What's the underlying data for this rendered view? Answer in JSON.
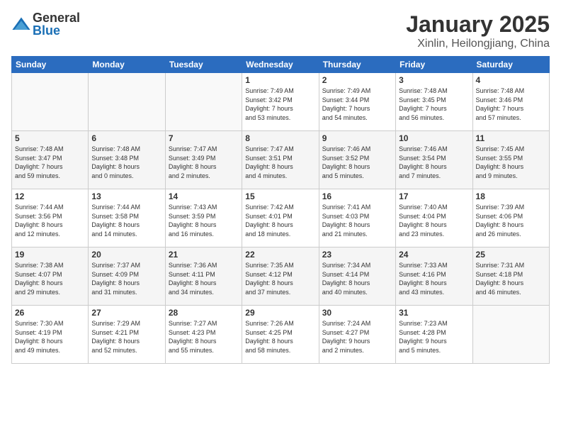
{
  "logo": {
    "general": "General",
    "blue": "Blue"
  },
  "header": {
    "month": "January 2025",
    "location": "Xinlin, Heilongjiang, China"
  },
  "days_of_week": [
    "Sunday",
    "Monday",
    "Tuesday",
    "Wednesday",
    "Thursday",
    "Friday",
    "Saturday"
  ],
  "weeks": [
    [
      {
        "day": "",
        "info": ""
      },
      {
        "day": "",
        "info": ""
      },
      {
        "day": "",
        "info": ""
      },
      {
        "day": "1",
        "info": "Sunrise: 7:49 AM\nSunset: 3:42 PM\nDaylight: 7 hours\nand 53 minutes."
      },
      {
        "day": "2",
        "info": "Sunrise: 7:49 AM\nSunset: 3:44 PM\nDaylight: 7 hours\nand 54 minutes."
      },
      {
        "day": "3",
        "info": "Sunrise: 7:48 AM\nSunset: 3:45 PM\nDaylight: 7 hours\nand 56 minutes."
      },
      {
        "day": "4",
        "info": "Sunrise: 7:48 AM\nSunset: 3:46 PM\nDaylight: 7 hours\nand 57 minutes."
      }
    ],
    [
      {
        "day": "5",
        "info": "Sunrise: 7:48 AM\nSunset: 3:47 PM\nDaylight: 7 hours\nand 59 minutes."
      },
      {
        "day": "6",
        "info": "Sunrise: 7:48 AM\nSunset: 3:48 PM\nDaylight: 8 hours\nand 0 minutes."
      },
      {
        "day": "7",
        "info": "Sunrise: 7:47 AM\nSunset: 3:49 PM\nDaylight: 8 hours\nand 2 minutes."
      },
      {
        "day": "8",
        "info": "Sunrise: 7:47 AM\nSunset: 3:51 PM\nDaylight: 8 hours\nand 4 minutes."
      },
      {
        "day": "9",
        "info": "Sunrise: 7:46 AM\nSunset: 3:52 PM\nDaylight: 8 hours\nand 5 minutes."
      },
      {
        "day": "10",
        "info": "Sunrise: 7:46 AM\nSunset: 3:54 PM\nDaylight: 8 hours\nand 7 minutes."
      },
      {
        "day": "11",
        "info": "Sunrise: 7:45 AM\nSunset: 3:55 PM\nDaylight: 8 hours\nand 9 minutes."
      }
    ],
    [
      {
        "day": "12",
        "info": "Sunrise: 7:44 AM\nSunset: 3:56 PM\nDaylight: 8 hours\nand 12 minutes."
      },
      {
        "day": "13",
        "info": "Sunrise: 7:44 AM\nSunset: 3:58 PM\nDaylight: 8 hours\nand 14 minutes."
      },
      {
        "day": "14",
        "info": "Sunrise: 7:43 AM\nSunset: 3:59 PM\nDaylight: 8 hours\nand 16 minutes."
      },
      {
        "day": "15",
        "info": "Sunrise: 7:42 AM\nSunset: 4:01 PM\nDaylight: 8 hours\nand 18 minutes."
      },
      {
        "day": "16",
        "info": "Sunrise: 7:41 AM\nSunset: 4:03 PM\nDaylight: 8 hours\nand 21 minutes."
      },
      {
        "day": "17",
        "info": "Sunrise: 7:40 AM\nSunset: 4:04 PM\nDaylight: 8 hours\nand 23 minutes."
      },
      {
        "day": "18",
        "info": "Sunrise: 7:39 AM\nSunset: 4:06 PM\nDaylight: 8 hours\nand 26 minutes."
      }
    ],
    [
      {
        "day": "19",
        "info": "Sunrise: 7:38 AM\nSunset: 4:07 PM\nDaylight: 8 hours\nand 29 minutes."
      },
      {
        "day": "20",
        "info": "Sunrise: 7:37 AM\nSunset: 4:09 PM\nDaylight: 8 hours\nand 31 minutes."
      },
      {
        "day": "21",
        "info": "Sunrise: 7:36 AM\nSunset: 4:11 PM\nDaylight: 8 hours\nand 34 minutes."
      },
      {
        "day": "22",
        "info": "Sunrise: 7:35 AM\nSunset: 4:12 PM\nDaylight: 8 hours\nand 37 minutes."
      },
      {
        "day": "23",
        "info": "Sunrise: 7:34 AM\nSunset: 4:14 PM\nDaylight: 8 hours\nand 40 minutes."
      },
      {
        "day": "24",
        "info": "Sunrise: 7:33 AM\nSunset: 4:16 PM\nDaylight: 8 hours\nand 43 minutes."
      },
      {
        "day": "25",
        "info": "Sunrise: 7:31 AM\nSunset: 4:18 PM\nDaylight: 8 hours\nand 46 minutes."
      }
    ],
    [
      {
        "day": "26",
        "info": "Sunrise: 7:30 AM\nSunset: 4:19 PM\nDaylight: 8 hours\nand 49 minutes."
      },
      {
        "day": "27",
        "info": "Sunrise: 7:29 AM\nSunset: 4:21 PM\nDaylight: 8 hours\nand 52 minutes."
      },
      {
        "day": "28",
        "info": "Sunrise: 7:27 AM\nSunset: 4:23 PM\nDaylight: 8 hours\nand 55 minutes."
      },
      {
        "day": "29",
        "info": "Sunrise: 7:26 AM\nSunset: 4:25 PM\nDaylight: 8 hours\nand 58 minutes."
      },
      {
        "day": "30",
        "info": "Sunrise: 7:24 AM\nSunset: 4:27 PM\nDaylight: 9 hours\nand 2 minutes."
      },
      {
        "day": "31",
        "info": "Sunrise: 7:23 AM\nSunset: 4:28 PM\nDaylight: 9 hours\nand 5 minutes."
      },
      {
        "day": "",
        "info": ""
      }
    ]
  ]
}
